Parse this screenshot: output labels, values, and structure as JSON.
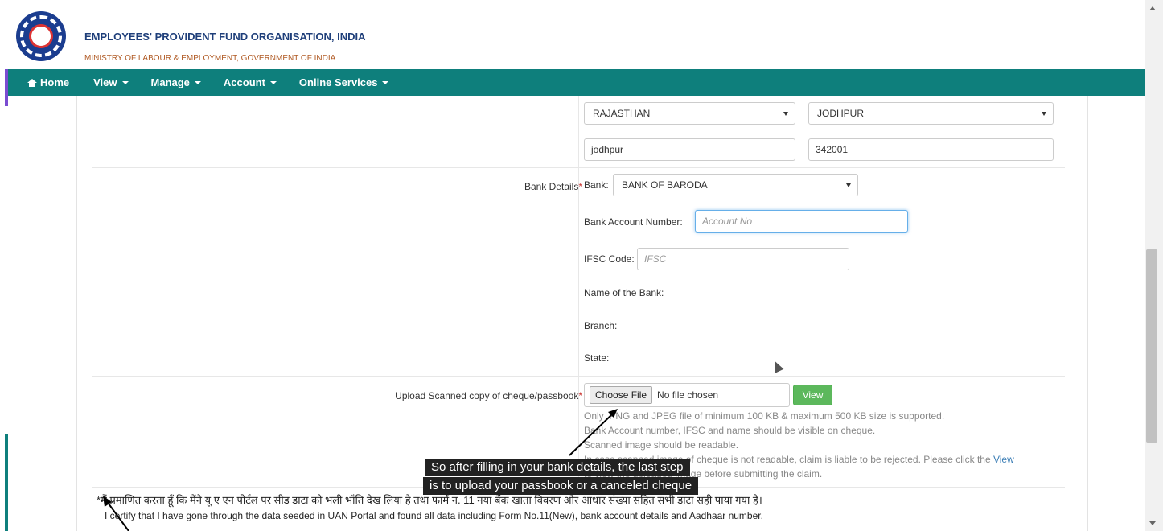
{
  "header": {
    "org_name": "EMPLOYEES' PROVIDENT FUND ORGANISATION, INDIA",
    "ministry": "MINISTRY OF LABOUR & EMPLOYMENT, GOVERNMENT OF INDIA"
  },
  "nav": {
    "items": [
      {
        "label": "Home",
        "icon": "home-icon"
      },
      {
        "label": "View"
      },
      {
        "label": "Manage"
      },
      {
        "label": "Account"
      },
      {
        "label": "Online Services"
      }
    ]
  },
  "address": {
    "state": "RAJASTHAN",
    "district": "JODHPUR",
    "city": "jodhpur",
    "pin": "342001"
  },
  "bank": {
    "section_label": "Bank Details",
    "bank_label": "Bank:",
    "bank_value": "BANK OF BARODA",
    "account_label": "Bank Account Number:",
    "account_placeholder": "Account No",
    "ifsc_label": "IFSC Code:",
    "ifsc_placeholder": "IFSC",
    "name_label": "Name of the Bank:",
    "branch_label": "Branch:",
    "state_label": "State:"
  },
  "upload": {
    "label": "Upload Scanned copy of cheque/passbook",
    "choose_btn": "Choose File",
    "no_file": "No file chosen",
    "view_btn": "View",
    "notes": [
      "Only .PNG and JPEG file of minimum 100 KB & maximum 500 KB size is supported.",
      "Bank Account number, IFSC and name should be visible on cheque.",
      "Scanned image should be readable.",
      "In case scanned image of cheque is not readable, claim is liable to be rejected. Please click the",
      "to view the uploaded image before submitting the claim."
    ],
    "view_link": "View"
  },
  "certification": {
    "hindi": "*मैं प्रमाणित करता हूँ कि मैंने यू ए एन पोर्टल पर सीड डाटा को भली भाँति देख लिया है तथा फार्म न. 11 नया बैंक खाता विवरण और आधार संख्या सहित सभी डाटा सही पाया गया है।",
    "english": "I certify that I have gone through the data seeded in UAN Portal and found all data including Form No.11(New), bank account details and Aadhaar number."
  },
  "caption": {
    "line1": "So after filling in your bank details, the last step",
    "line2": "is to upload your passbook or a canceled cheque"
  },
  "colors": {
    "navbar": "#0e7f7c",
    "org_name": "#1f3f7a",
    "ministry": "#b05a24",
    "view_button": "#5cb85c"
  }
}
